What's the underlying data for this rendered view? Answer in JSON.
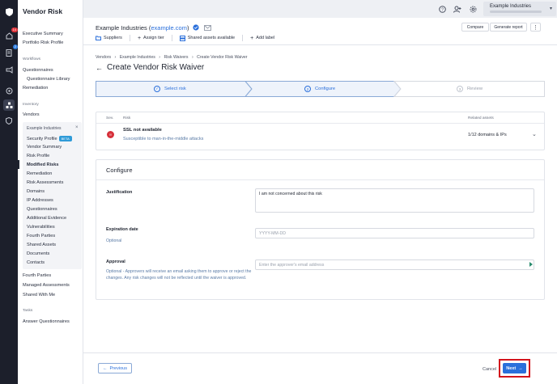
{
  "rail": {
    "badges": {
      "home": "14",
      "questionnaires": "2"
    }
  },
  "sidebar": {
    "title": "Vendor Risk",
    "items_top": [
      "Executive Summary",
      "Portfolio Risk Profile"
    ],
    "workflows_heading": "Workflows",
    "workflows": [
      "Questionnaires",
      "Questionnaire Library",
      "Remediation"
    ],
    "inventory_heading": "Inventory",
    "vendors_label": "Vendors",
    "vendor_group": {
      "name": "Example Industries",
      "close": "×",
      "items": [
        "Security Profile",
        "Vendor Summary",
        "Risk Profile",
        "Modified Risks",
        "Remediation",
        "Risk Assessments",
        "Domains",
        "IP Addresses",
        "Questionnaires",
        "Additional Evidence",
        "Vulnerabilities",
        "Fourth Parties",
        "Shared Assets",
        "Documents",
        "Contacts"
      ],
      "beta": "BETA"
    },
    "items_bottom": [
      "Fourth Parties",
      "Managed Assessments",
      "Shared With Me"
    ],
    "tasks_heading": "Tasks",
    "tasks": [
      "Answer Questionnaires"
    ]
  },
  "topbar": {
    "account_name": "Example Industries"
  },
  "vendor_header": {
    "name": "Example Industries",
    "domain": "example.com",
    "actions": [
      "Suppliers",
      "Assign tier",
      "Shared assets available",
      "Add label"
    ],
    "compare": "Compare",
    "generate_report": "Generate report",
    "more": "⋮"
  },
  "main": {
    "breadcrumbs": [
      "Vendors",
      "Example Industries",
      "Risk Waivers",
      "Create Vendor Risk Waiver"
    ],
    "page_title": "Create Vendor Risk Waiver",
    "steps": [
      {
        "num": "✓",
        "label": "Select risk"
      },
      {
        "num": "2",
        "label": "Configure"
      },
      {
        "num": "3",
        "label": "Review"
      }
    ],
    "risk_table": {
      "col_sev": "Sev.",
      "col_risk": "Risk",
      "col_assets": "Related assets",
      "row": {
        "sev_badge": "!!!",
        "title": "SSL not available",
        "subtitle": "Susceptible to man-in-the-middle attacks",
        "assets": "1/12 domains & IPs"
      }
    },
    "configure": {
      "title": "Configure",
      "justification_label": "Justification",
      "justification_value": "I am not concerned about this risk",
      "expiration_label": "Expiration date",
      "expiration_help": "Optional",
      "expiration_placeholder": "YYYY-MM-DD",
      "approval_label": "Approval",
      "approval_help": "Optional - Approvers will receive an email asking them to approve or reject the changes. Any risk changes will not be reflected until the waiver is approved.",
      "approval_placeholder": "Enter the approver's email address"
    },
    "footer": {
      "previous": "Previous",
      "cancel": "Cancel",
      "next": "Next"
    }
  },
  "colors": {
    "accent": "#2a6fdb",
    "highlight_outline": "#d3141c",
    "severity": "#d6303a",
    "rail_bg": "#1c1f2b"
  }
}
